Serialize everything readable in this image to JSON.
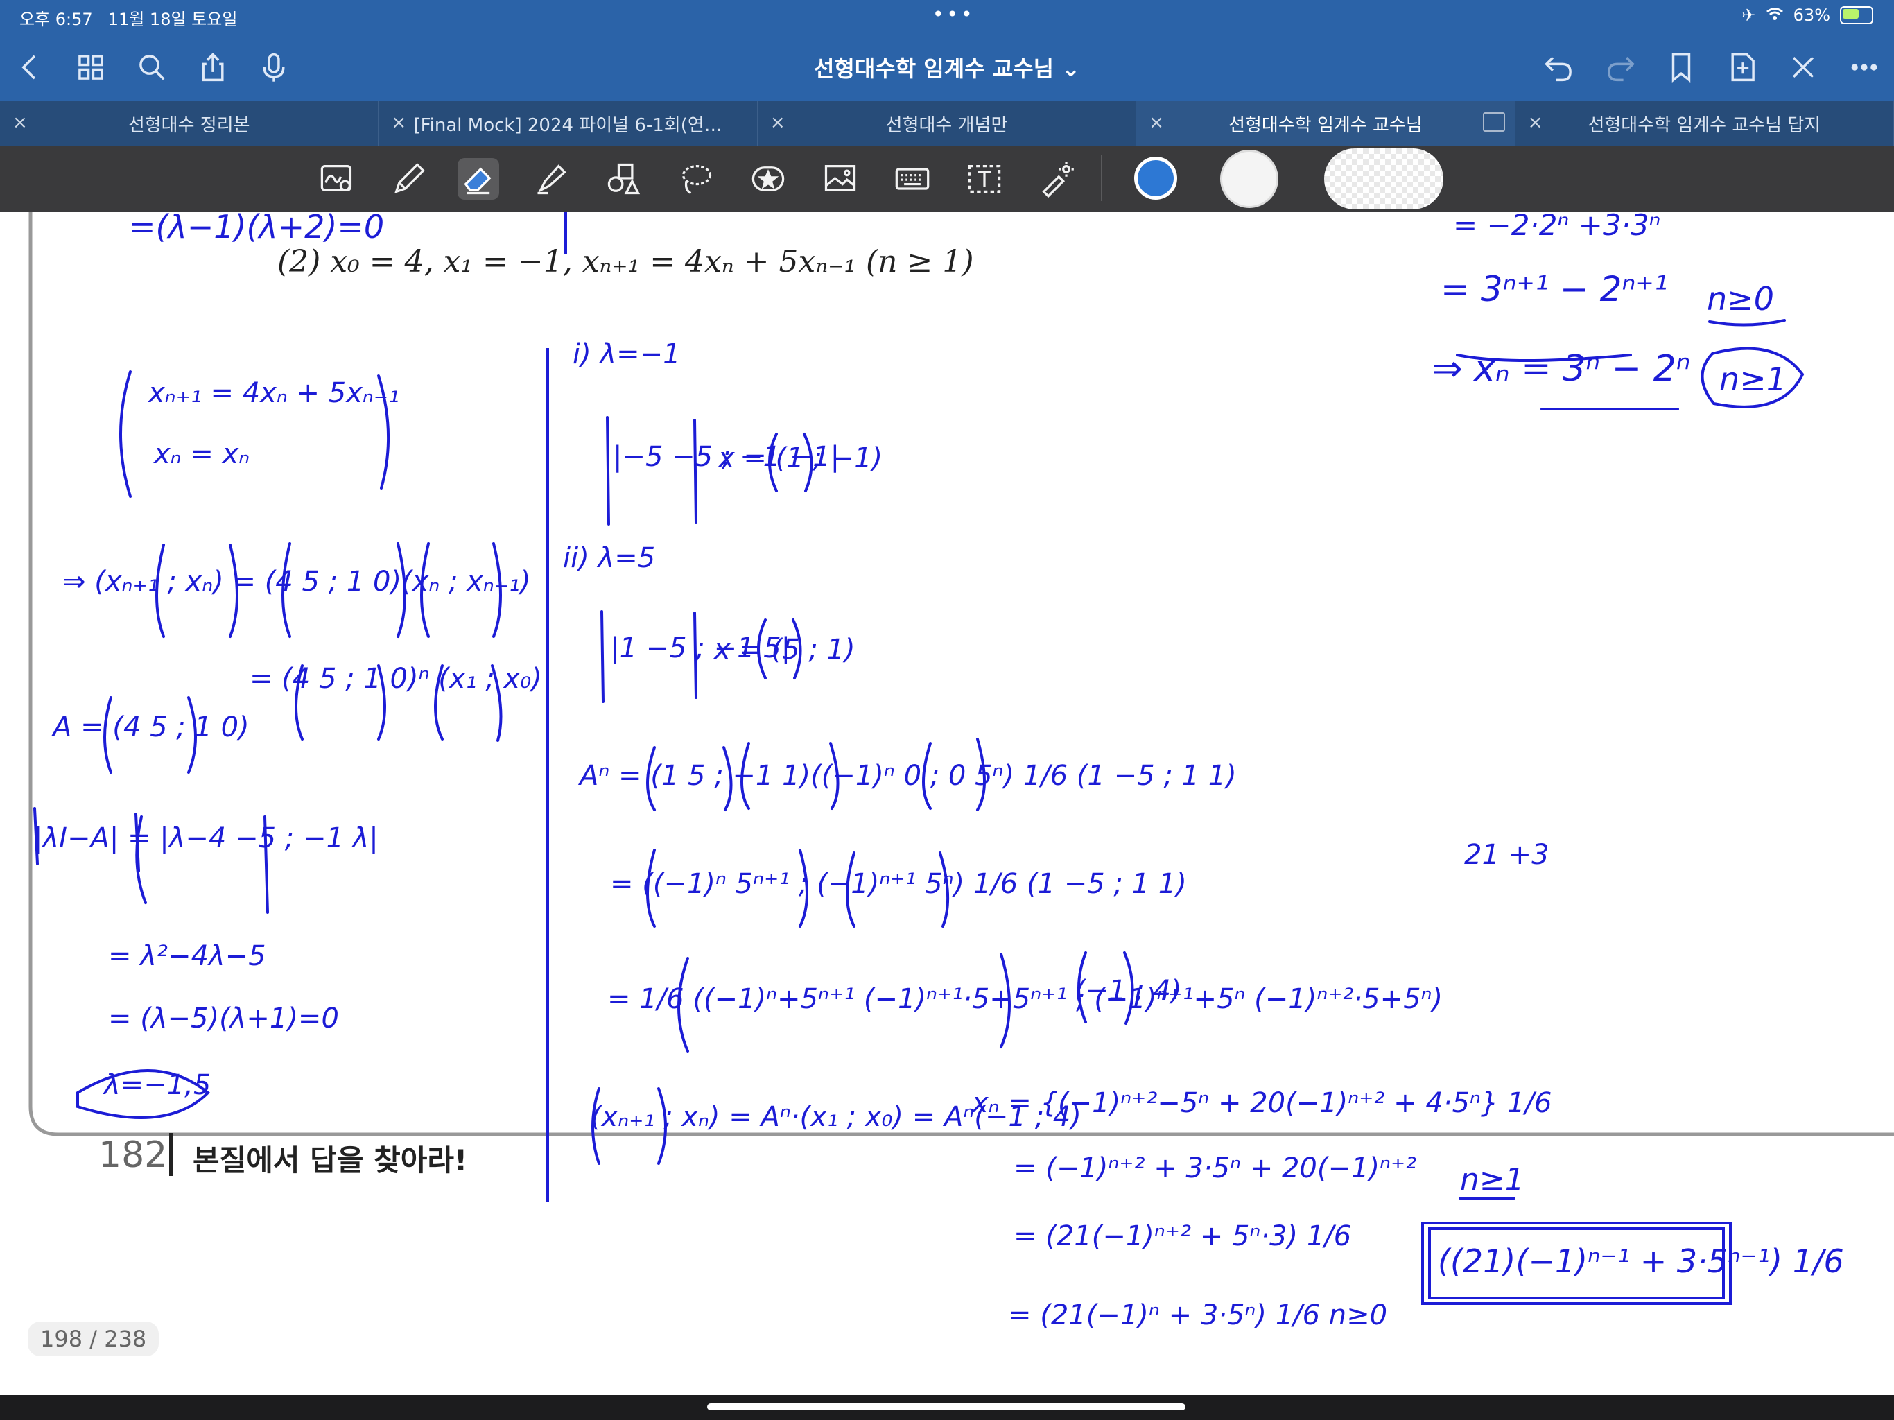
{
  "status": {
    "time": "오후 6:57",
    "date": "11월 18일 토요일",
    "dots": "•••",
    "battery": "63%",
    "battery_level": 0.63
  },
  "nav": {
    "title": "선형대수학 임계수 교수님 ⌄",
    "icons": [
      "back-icon",
      "grid-icon",
      "search-icon",
      "share-icon",
      "mic-icon",
      "undo-icon",
      "redo-icon",
      "bookmark-icon",
      "add-page-icon",
      "close-icon",
      "more-icon"
    ]
  },
  "tabs": [
    {
      "label": "선형대수 정리본",
      "active": false
    },
    {
      "label": "[Final Mock] 2024 파이널 6-1회(연…",
      "active": false
    },
    {
      "label": "선형대수 개념만",
      "active": false
    },
    {
      "label": "선형대수학 임계수 교수님",
      "active": true
    },
    {
      "label": "선형대수학 임계수 교수님 답지",
      "active": false
    }
  ],
  "toolbar": {
    "tools": [
      "lasso-zoom-icon",
      "pen-icon",
      "eraser-icon",
      "highlighter-icon",
      "shapes-icon",
      "lasso-icon",
      "sticker-icon",
      "image-icon",
      "keyboard-icon",
      "text-icon",
      "laser-pointer-icon"
    ],
    "colors": [
      "#2d78d4",
      "#ffffff",
      "#ffffff"
    ]
  },
  "page": {
    "problem": "(2) x₀ = 4, x₁ = −1, xₙ₊₁ = 4xₙ + 5xₙ₋₁   (n ≥ 1)",
    "footer_number": "182",
    "footer_text": "본질에서 답을 찾아라!",
    "page_counter": "198 / 238",
    "handwriting": {
      "top_left": "=(λ−1)(λ+2)=0",
      "right_1": "= −2·2ⁿ +3·3ⁿ",
      "right_2": "= 3ⁿ⁺¹ − 2ⁿ⁺¹",
      "right_3": "n≥0",
      "right_4": "⇒ xₙ = 3ⁿ − 2ⁿ",
      "right_5": "n≥1",
      "sys_1": "xₙ₊₁ = 4xₙ + 5xₙ₋₁",
      "sys_2": "xₙ = xₙ",
      "mat_1": "⇒ (xₙ₊₁ ; xₙ) = (4 5 ; 1 0)(xₙ ; xₙ₋₁)",
      "mat_2": "= (4 5 ; 1 0)ⁿ (x₁ ; x₀)",
      "a_def": "A = (4 5 ; 1 0)",
      "char_1": "|λI−A| = |λ−4 −5 ; −1 λ|",
      "char_2": "= λ²−4λ−5",
      "char_3": "= (λ−5)(λ+1)=0",
      "char_4": "λ=−1,5",
      "e1_head": "i) λ=−1",
      "e1_mat": "|−5 −5 ; −1 −1|",
      "e1_vec": "x = (1 ; −1)",
      "e2_head": "ii) λ=5",
      "e2_mat": "|1 −5 ; −1 5|",
      "e2_vec": "x = (5 ; 1)",
      "an_1": "Aⁿ = (1 5 ; −1 1)((−1)ⁿ 0 ; 0 5ⁿ) 1/6 (1 −5 ; 1 1)",
      "an_2": "= ((−1)ⁿ 5ⁿ⁺¹ ; (−1)ⁿ⁺¹ 5ⁿ) 1/6 (1 −5 ; 1 1)",
      "an_3": "= 1/6 ((−1)ⁿ+5ⁿ⁺¹  (−1)ⁿ⁺¹·5+5ⁿ⁺¹ ; (−1)ⁿ⁺¹+5ⁿ  (−1)ⁿ⁺²·5+5ⁿ)",
      "an_vec": "(−1 ; 4)",
      "res_1": "(xₙ₊₁ ; xₙ) = Aⁿ·(x₁ ; x₀) = Aⁿ(−1 ; 4)",
      "res_2": "xₙ = {(−1)ⁿ⁺²−5ⁿ + 20(−1)ⁿ⁺² + 4·5ⁿ} 1/6",
      "res_3": "= (−1)ⁿ⁺² + 3·5ⁿ + 20(−1)ⁿ⁺²",
      "res_4": "= (21(−1)ⁿ⁺² + 5ⁿ·3) 1/6",
      "res_5": "= (21(−1)ⁿ + 3·5ⁿ) 1/6   n≥0",
      "side_note": "21 +3",
      "boxed_cond": "n≥1",
      "boxed_answer": "((21)(−1)ⁿ⁻¹ + 3·5ⁿ⁻¹) 1/6"
    }
  }
}
